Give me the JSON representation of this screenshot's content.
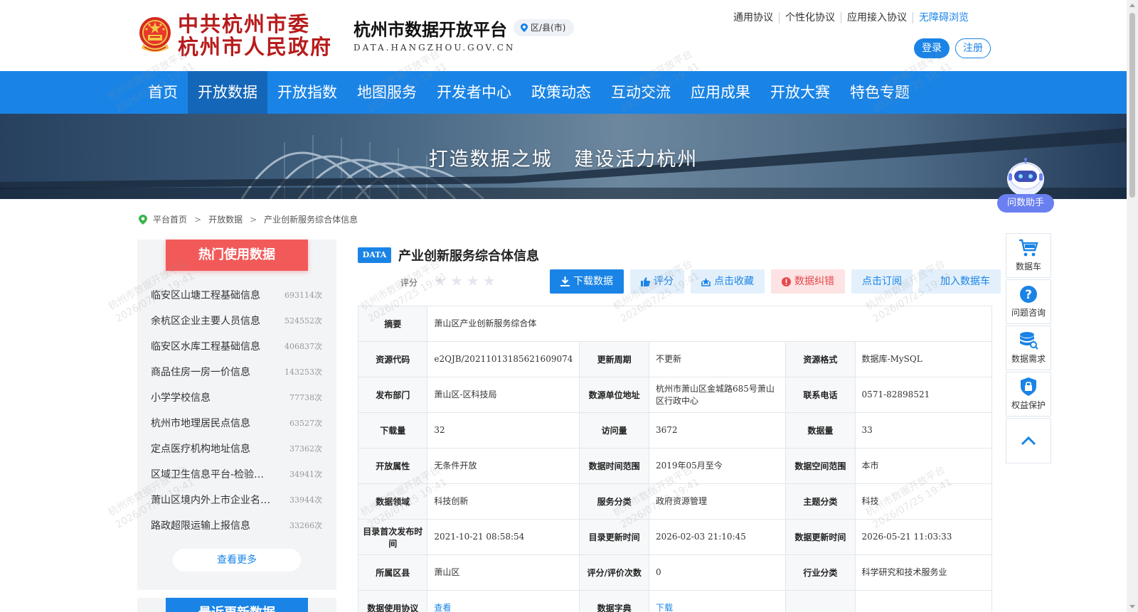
{
  "header": {
    "gov_line1": "中共杭州市委",
    "gov_line2": "杭州市人民政府",
    "platform_title": "杭州市数据开放平台",
    "platform_domain": "DATA.HANGZHOU.GOV.CN",
    "region_label": "区/县(市)",
    "top_links": [
      "通用协议",
      "个性化协议",
      "应用接入协议",
      "无障碍浏览"
    ],
    "login_label": "登录",
    "register_label": "注册"
  },
  "nav": {
    "items": [
      "首页",
      "开放数据",
      "开放指数",
      "地图服务",
      "开发者中心",
      "政策动态",
      "互动交流",
      "应用成果",
      "开放大赛",
      "特色专题"
    ],
    "active_index": 1
  },
  "banner": {
    "slogan": "打造数据之城   建设活力杭州"
  },
  "assistant": {
    "label": "问数助手"
  },
  "breadcrumb": {
    "items": [
      "平台首页",
      "开放数据",
      "产业创新服务综合体信息"
    ],
    "separator": ">"
  },
  "sidebar": {
    "hot_title": "热门使用数据",
    "hot_items": [
      {
        "name": "临安区山塘工程基础信息",
        "count": "693114次"
      },
      {
        "name": "余杭区企业主要人员信息",
        "count": "524552次"
      },
      {
        "name": "临安区水库工程基础信息",
        "count": "406837次"
      },
      {
        "name": "商品住房一房一价信息",
        "count": "143253次"
      },
      {
        "name": "小学学校信息",
        "count": "77738次"
      },
      {
        "name": "杭州市地理居民点信息",
        "count": "63527次"
      },
      {
        "name": "定点医疗机构地址信息",
        "count": "37362次"
      },
      {
        "name": "区域卫生信息平台-检验…",
        "count": "34941次"
      },
      {
        "name": "萧山区境内外上市企业名…",
        "count": "33944次"
      },
      {
        "name": "路政超限运输上报信息",
        "count": "33266次"
      }
    ],
    "more_label": "查看更多",
    "recent_title": "最近更新数据"
  },
  "main": {
    "tag": "DATA",
    "title": "产业创新服务综合体信息",
    "rating_label": "评分",
    "star_count": 4,
    "actions": {
      "download": "下载数据",
      "rate": "评分",
      "favorite": "点击收藏",
      "error": "数据纠错",
      "subscribe": "点击订阅",
      "add_cart": "加入数据车"
    },
    "summary_label": "摘要",
    "summary_value": "萧山区产业创新服务综合体",
    "rows": [
      [
        {
          "label": "资源代码",
          "value": "e2QJB/20211013185621609074"
        },
        {
          "label": "更新周期",
          "value": "不更新"
        },
        {
          "label": "资源格式",
          "value": "数据库-MySQL"
        }
      ],
      [
        {
          "label": "发布部门",
          "value": "萧山区-区科技局"
        },
        {
          "label": "数源单位地址",
          "value": "杭州市萧山区金城路685号萧山区行政中心"
        },
        {
          "label": "联系电话",
          "value": "0571-82898521"
        }
      ],
      [
        {
          "label": "下载量",
          "value": "32"
        },
        {
          "label": "访问量",
          "value": "3672"
        },
        {
          "label": "数据量",
          "value": "33"
        }
      ],
      [
        {
          "label": "开放属性",
          "value": "无条件开放"
        },
        {
          "label": "数据时间范围",
          "value": "2019年05月至今"
        },
        {
          "label": "数据空间范围",
          "value": "本市"
        }
      ],
      [
        {
          "label": "数据领域",
          "value": "科技创新"
        },
        {
          "label": "服务分类",
          "value": "政府资源管理"
        },
        {
          "label": "主题分类",
          "value": "科技"
        }
      ],
      [
        {
          "label": "目录首次发布时间",
          "value": "2021-10-21 08:58:54"
        },
        {
          "label": "目录更新时间",
          "value": "2026-02-03 21:10:45"
        },
        {
          "label": "数据更新时间",
          "value": "2026-05-21 11:03:33"
        }
      ],
      [
        {
          "label": "所属区县",
          "value": "萧山区"
        },
        {
          "label": "评分/评价次数",
          "value": "0"
        },
        {
          "label": "行业分类",
          "value": "科学研究和技术服务业"
        }
      ]
    ],
    "agreement_label": "数据使用协议",
    "agreement_link": "查看",
    "dictionary_label": "数据字典",
    "dictionary_link": "下载"
  },
  "float_bar": {
    "cart": "数据车",
    "consult": "问题咨询",
    "demand": "数据需求",
    "rights": "权益保护"
  },
  "watermark": {
    "line1": "杭州市数据开放平台",
    "line2": "2026/07/25 19:41"
  },
  "colors": {
    "primary": "#1a84e6",
    "nav_active": "#1466b8",
    "hot_red": "#f25a5a",
    "danger": "#e5484d",
    "gov_red": "#b71c1c"
  }
}
